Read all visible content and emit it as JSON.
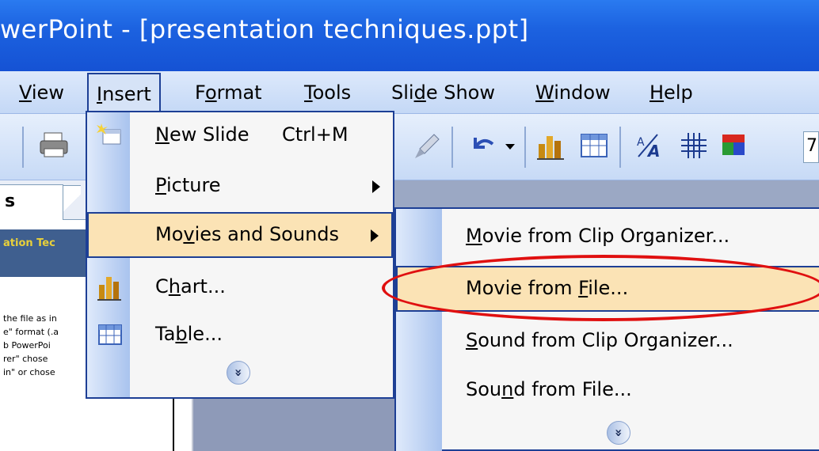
{
  "window": {
    "title": "werPoint - [presentation techniques.ppt]"
  },
  "menubar": {
    "items": [
      {
        "label": "View",
        "underline": "V",
        "rest": "iew"
      },
      {
        "label": "Insert",
        "underline": "I",
        "rest": "nsert"
      },
      {
        "label": "Format",
        "pre": "F",
        "underline": "o",
        "rest": "rmat"
      },
      {
        "label": "Tools",
        "underline": "T",
        "rest": "ools"
      },
      {
        "label": "Slide Show",
        "pre": "Sli",
        "underline": "d",
        "rest": "e Show"
      },
      {
        "label": "Window",
        "underline": "W",
        "rest": "indow"
      },
      {
        "label": "Help",
        "underline": "H",
        "rest": "elp"
      }
    ]
  },
  "toolbar": {
    "zoom_partial": "7"
  },
  "left_pane": {
    "tab_label": "s",
    "thumb_title": "ation Tec",
    "thumb_lines": [
      "the file as in",
      "e\" format (.a",
      "b PowerPoi",
      "rer\" chose",
      "in\" or chose"
    ]
  },
  "insert_menu": {
    "items": [
      {
        "label": "New Slide",
        "underline": "N",
        "rest": "ew Slide",
        "shortcut": "Ctrl+M"
      },
      {
        "label": "Picture",
        "underline": "P",
        "rest": "icture"
      },
      {
        "label": "Movies and Sounds",
        "pre": "Mo",
        "underline": "v",
        "rest": "ies and Sounds"
      },
      {
        "label": "Chart...",
        "pre": "C",
        "underline": "h",
        "rest": "art..."
      },
      {
        "label": "Table...",
        "pre": "Ta",
        "underline": "b",
        "rest": "le..."
      }
    ],
    "expand_glyph": "»"
  },
  "movies_submenu": {
    "items": [
      {
        "label": "Movie from Clip Organizer...",
        "underline": "M",
        "rest": "ovie from Clip Organizer..."
      },
      {
        "label": "Movie from File...",
        "pre": "Movie from ",
        "underline": "F",
        "rest": "ile..."
      },
      {
        "label": "Sound from Clip Organizer...",
        "underline": "S",
        "rest": "ound from Clip Organizer..."
      },
      {
        "label": "Sound from File...",
        "pre": "Sou",
        "underline": "n",
        "rest": "d from File..."
      }
    ],
    "expand_glyph": "»"
  },
  "colors": {
    "title_bar": "#1c62e0",
    "menu_highlight": "#fbe3b5",
    "menu_border": "#1d3f95",
    "annotation": "#e01010"
  }
}
